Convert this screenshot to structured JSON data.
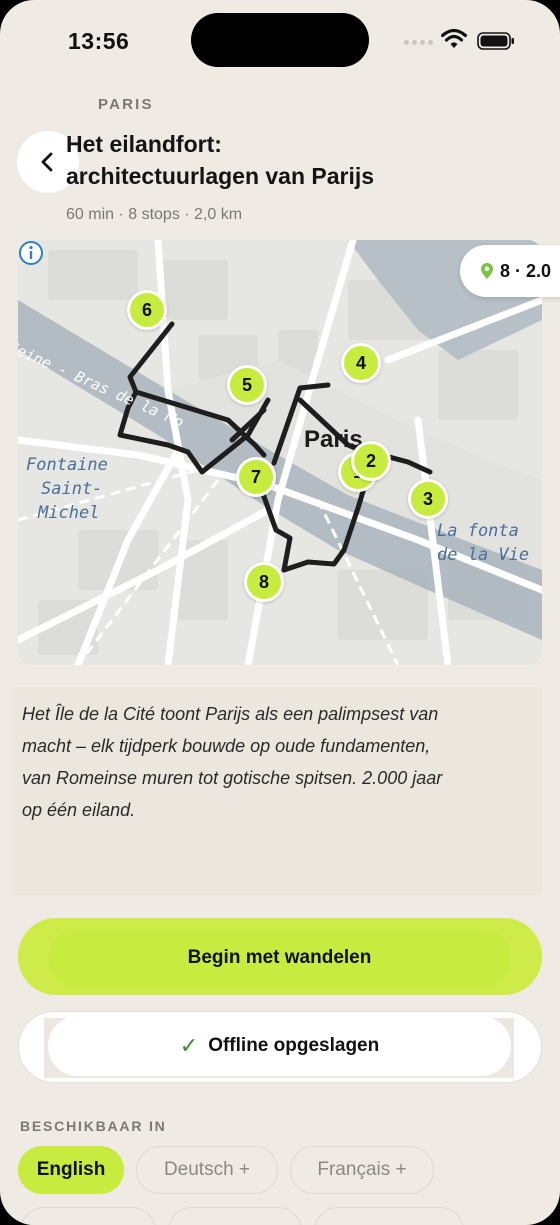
{
  "status_bar": {
    "time": "13:56"
  },
  "header": {
    "city": "PARIS",
    "title_line1": "Het eilandfort:",
    "title_line2": "architectuurlagen van Parijs",
    "meta": "60 min · 8 stops · 2,0 km"
  },
  "map": {
    "stops_chip": "8 · 2.0",
    "labels": {
      "seine": "Seine - Bras de la Mo",
      "fontaine_1": "Fontaine",
      "fontaine_2": "Saint-",
      "fontaine_3": "Michel",
      "fontal_1": "La fonta",
      "fontal_2": "de la Vie",
      "paris": "Paris"
    },
    "pins": [
      {
        "n": "6"
      },
      {
        "n": "5"
      },
      {
        "n": "4"
      },
      {
        "n": "7"
      },
      {
        "n": "1"
      },
      {
        "n": "2"
      },
      {
        "n": "3"
      },
      {
        "n": "8"
      }
    ]
  },
  "description": "Het Île de la Cité toont Parijs als een palimpsest van macht – elk tijdperk bouwde op oude fundamenten, van Romeinse muren tot gotische spitsen. 2.000 jaar op één eiland.",
  "actions": {
    "begin_label": "Begin met wandelen",
    "offline_label": "Offline opgeslagen",
    "offline_check": "✓"
  },
  "languages": {
    "heading": "BESCHIKBAAR IN",
    "items": [
      {
        "label": "English",
        "active": true
      },
      {
        "label": "Deutsch +",
        "active": false
      },
      {
        "label": "Français +",
        "active": false
      }
    ]
  },
  "colors": {
    "accent": "#c7ec3f",
    "background": "#efebe4",
    "route": "#1e1e1e",
    "water": "#a9b4bd"
  }
}
